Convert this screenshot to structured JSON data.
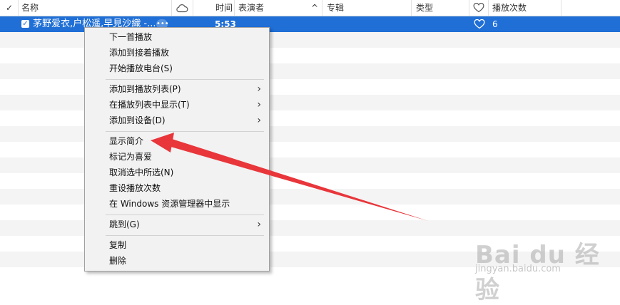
{
  "header": {
    "check": "✓",
    "name": "名称",
    "time": "时间",
    "artist": "表演者",
    "sort_indicator": "^",
    "album": "专辑",
    "genre": "类型",
    "plays": "播放次数"
  },
  "selected_row": {
    "check": "✓",
    "name": "茅野爱衣,户松遥,早見沙織 -...",
    "more": "•••",
    "time": "5:53",
    "plays": "6"
  },
  "context_menu": {
    "items": [
      {
        "label": "下一首播放"
      },
      {
        "label": "添加到接着播放"
      },
      {
        "label": "开始播放电台(S)"
      },
      {
        "label": "添加到播放列表(P)",
        "arrow": "›"
      },
      {
        "label": "在播放列表中显示(T)",
        "arrow": "›"
      },
      {
        "label": "添加到设备(D)",
        "arrow": "›"
      },
      {
        "label": "显示简介"
      },
      {
        "label": "标记为喜爱"
      },
      {
        "label": "取消选中所选(N)"
      },
      {
        "label": "重设播放次数"
      },
      {
        "label": "在 Windows 资源管理器中显示"
      },
      {
        "label": "跳到(G)",
        "arrow": "›"
      },
      {
        "label": "复制"
      },
      {
        "label": "删除"
      }
    ]
  },
  "watermark": {
    "logo": "Bai du 经验",
    "url": "jingyan.baidu.com"
  },
  "colors": {
    "selection": "#1f6fd6",
    "annotation_arrow": "#e8363b"
  }
}
